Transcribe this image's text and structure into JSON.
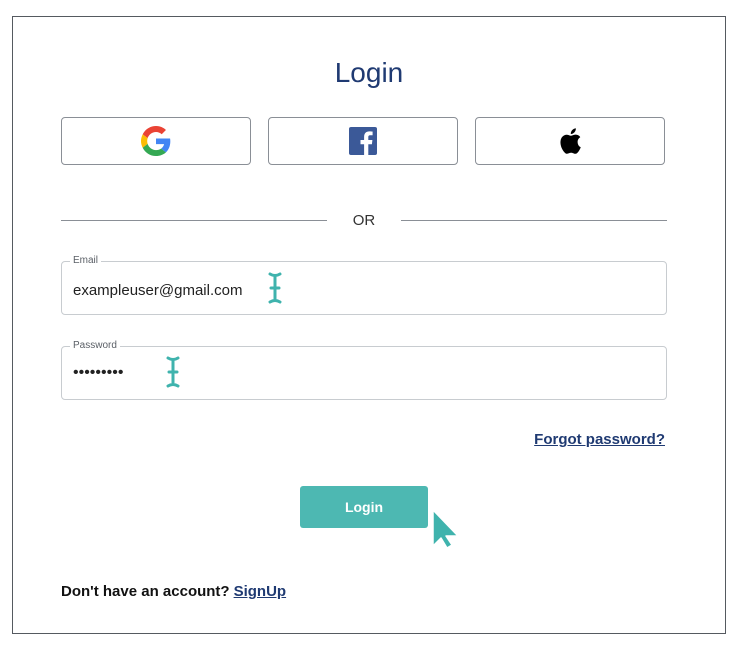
{
  "page": {
    "title": "Login"
  },
  "social": {
    "buttons": [
      {
        "icon": "google-icon",
        "provider": "Google"
      },
      {
        "icon": "facebook-icon",
        "provider": "Facebook"
      },
      {
        "icon": "apple-icon",
        "provider": "Apple"
      }
    ]
  },
  "divider": {
    "label": "OR"
  },
  "form": {
    "email": {
      "label": "Email",
      "value": "exampleuser@gmail.com"
    },
    "password": {
      "label": "Password",
      "value": "•••••••••"
    },
    "forgot_label": "Forgot password?",
    "submit_label": "Login"
  },
  "footer": {
    "prompt": "Don't have an account?",
    "signup_label": "SignUp"
  },
  "colors": {
    "brand_navy": "#1f3a72",
    "accent_teal": "#4db8b2",
    "facebook_blue": "#3b5998"
  }
}
